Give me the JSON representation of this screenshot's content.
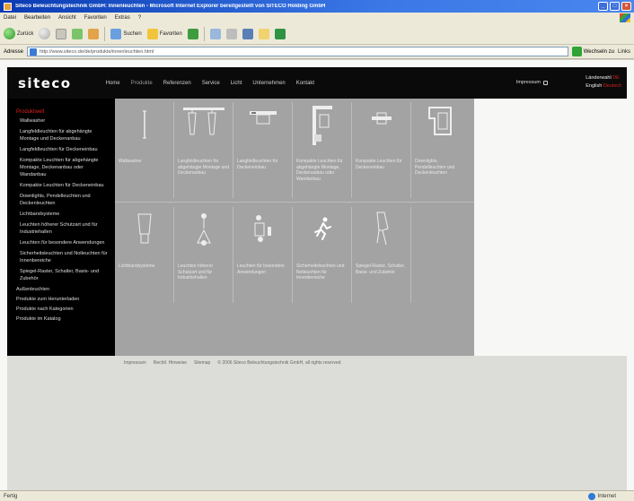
{
  "window": {
    "title": "Siteco Beleuchtungstechnik GmbH: Innenleuchten - Microsoft Internet Explorer bereitgestellt von SITECO Holding GmbH",
    "controls": {
      "minimize": "_",
      "maximize": "□",
      "close": "×"
    }
  },
  "menu": [
    "Datei",
    "Bearbeiten",
    "Ansicht",
    "Favoriten",
    "Extras",
    "?"
  ],
  "toolbar": {
    "back": "Zurück",
    "search": "Suchen",
    "favorites": "Favoriten"
  },
  "address": {
    "label": "Adresse",
    "url": "http://www.siteco.de/de/produkte/innenleuchten.html",
    "go": "Wechseln zu",
    "links": "Links"
  },
  "site": {
    "logo": "siteco",
    "nav": [
      "Home",
      "Produkte",
      "Referenzen",
      "Service",
      "Licht",
      "Unternehmen",
      "Kontakt"
    ],
    "header_right": "Impressum",
    "lang_line1": "Länderwahl",
    "lang_line1_accent": "DE",
    "lang_line2": "English",
    "lang_line2_accent": "Deutsch"
  },
  "sidebar": {
    "title": "Produktwelt",
    "sub_items": [
      "Wallwasher",
      "Langfeldleuchten für abgehängte Montage und Deckenanbau",
      "Langfeldleuchten für Deckeneinbau",
      "Kompakte Leuchten für abgehängte Montage, Deckenanbau oder Wandanbau",
      "Kompakte Leuchten für Deckeneinbau",
      "Downlights, Pendelleuchten und Deckenleuchten",
      "Lichtbandsysteme",
      "Leuchten höherer Schutzart und für Industriehallen",
      "Leuchten für besondere Anwendungen",
      "Sicherheitsleuchten und Notleuchten für Innenbereiche",
      "Spiegel-Raster, Schalter, Basis- und Zubehör"
    ],
    "main_items": [
      "Außenleuchten",
      "Produkte zum Herunterladen",
      "Produkte nach Kategorien",
      "Produkte im Katalog"
    ]
  },
  "products": [
    {
      "icon": "wallwasher-icon",
      "name": "Wallwasher"
    },
    {
      "icon": "pendant-double-icon",
      "name": "Langfeldleuchten für abgehängte Montage und Deckenanbau"
    },
    {
      "icon": "recessed-linear-icon",
      "name": "Langfeldleuchten für Deckeneinbau"
    },
    {
      "icon": "wall-compact-icon",
      "name": "Kompakte Leuchten für abgehängte Montage, Deckenanbau oder Wandanbau"
    },
    {
      "icon": "recessed-compact-icon",
      "name": "Kompakte Leuchten für Deckeneinbau"
    },
    {
      "icon": "downlight-icon",
      "name": "Downlights, Pendelleuchten und Deckenleuchten"
    },
    {
      "icon": "light-band-icon",
      "name": "Lichtbandsysteme"
    },
    {
      "icon": "industrial-icon",
      "name": "Leuchten höherer Schutzart und für Industriehallen"
    },
    {
      "icon": "special-icon",
      "name": "Leuchten für besondere Anwendungen"
    },
    {
      "icon": "emergency-icon",
      "name": "Sicherheitsleuchten und Notleuchten für Innenbereiche"
    },
    {
      "icon": "accessory-icon",
      "name": "Spiegel-Raster, Schalter, Basis- und Zubehör"
    }
  ],
  "footer": [
    "Impressum",
    "Rechtl. Hinweise",
    "Sitemap",
    "© 2006 Siteco Beleuchtungstechnik GmbH, all rights reserved"
  ],
  "status": {
    "text": "Fertig",
    "zone": "Internet"
  },
  "colors": {
    "accent_red": "#d62020",
    "header_black": "#0a0a0a",
    "tile_grey": "#a3a3a3"
  }
}
